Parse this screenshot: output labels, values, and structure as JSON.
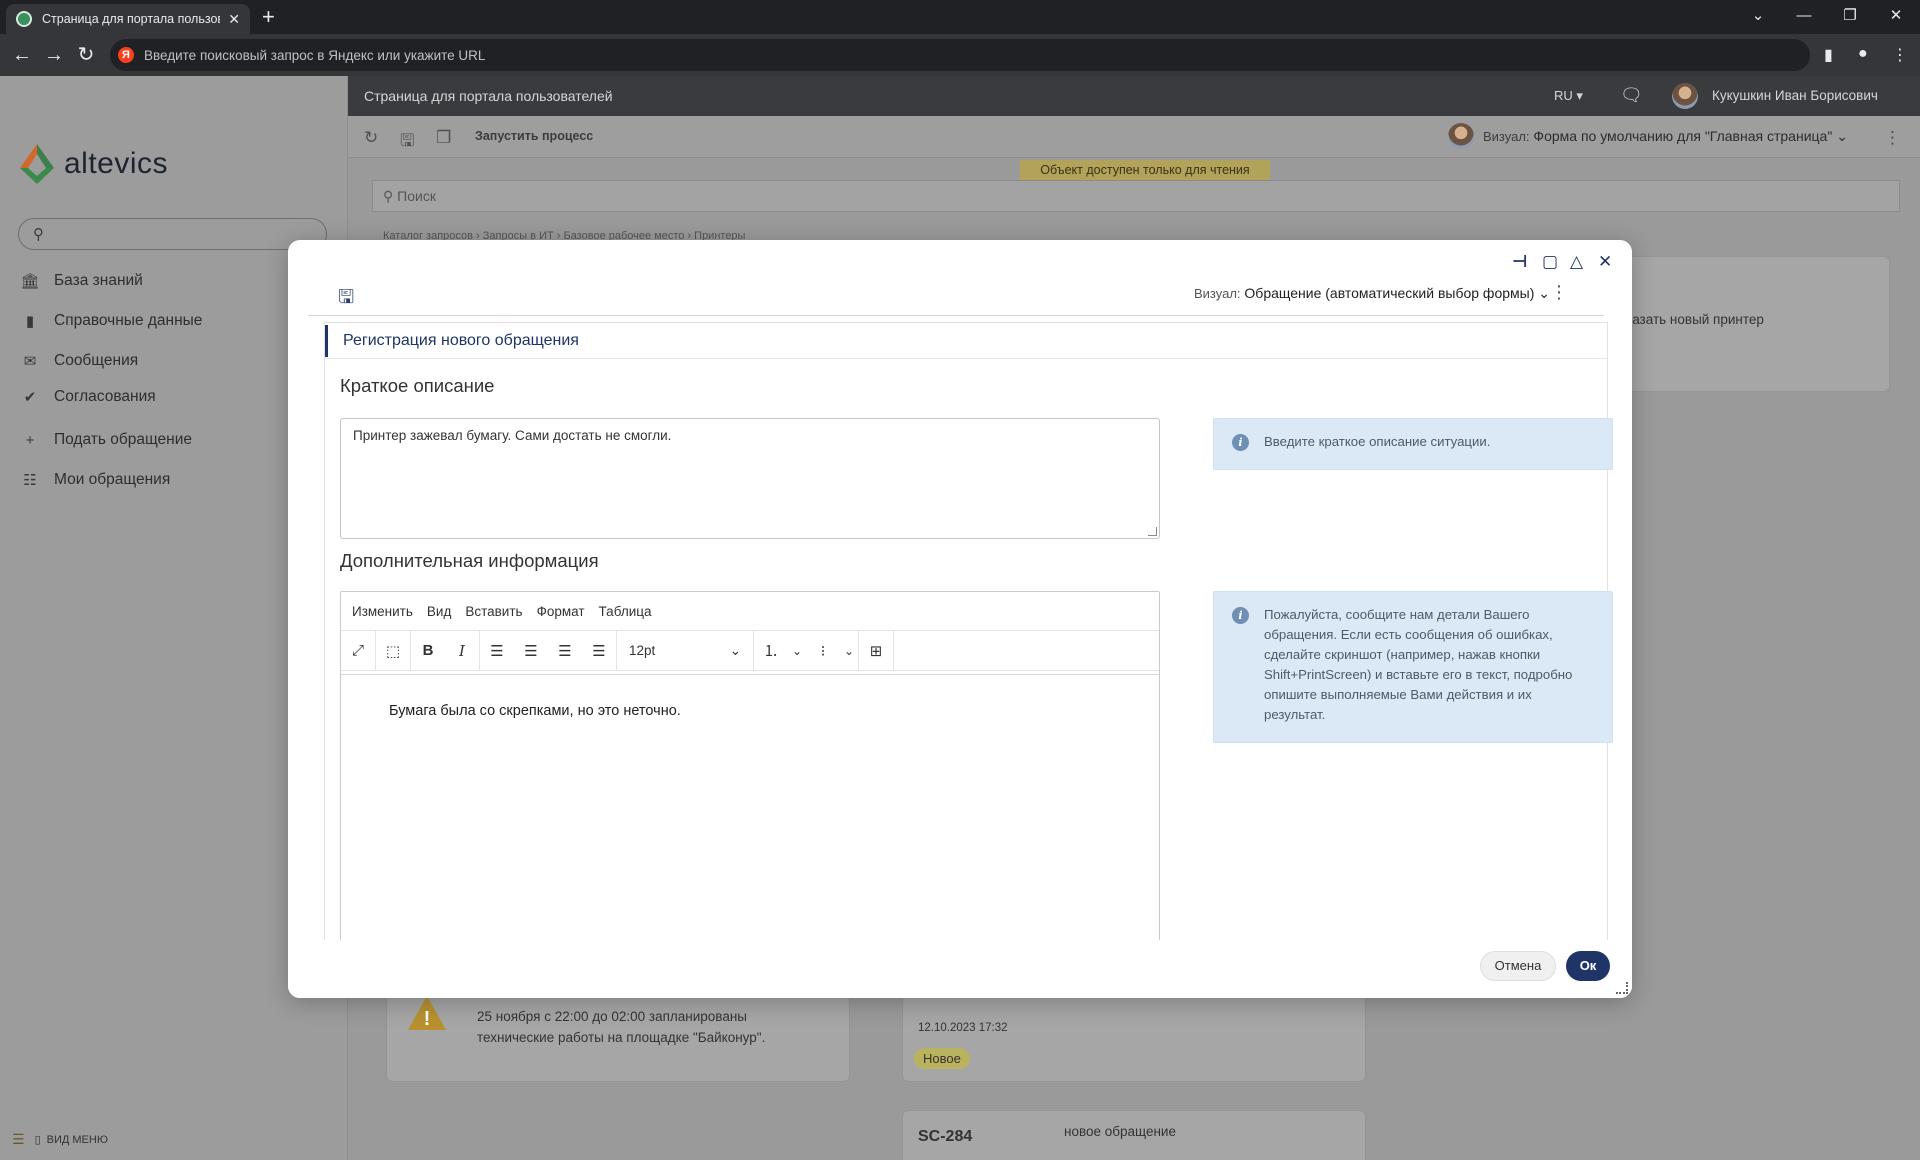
{
  "browser": {
    "tab_title": "Страница для портала пользов",
    "tab_close": "✕",
    "new_tab": "+",
    "address_placeholder": "Введите поисковый запрос в Яндекс или укажите URL",
    "yandex_letter": "Я"
  },
  "app": {
    "title": "Страница для портала пользователей",
    "lang": "RU ▾",
    "user_name": "Кукушкин Иван Борисович",
    "logo_text": "altevics",
    "toolbar": {
      "run_process": "Запустить процесс",
      "visual_label": "Визуал:",
      "visual_value": "Форма по умолчанию для \"Главная страница\""
    },
    "readonly_banner": "Объект доступен только для чтения",
    "search_placeholder": "Поиск",
    "breadcrumbs": "Каталог запросов › Запросы в ИТ › Базовое рабочее место › Принтеры"
  },
  "sidebar": {
    "items": [
      {
        "icon": "bank-icon",
        "label": "База знаний"
      },
      {
        "icon": "book-icon",
        "label": "Справочные данные"
      },
      {
        "icon": "envelope-icon",
        "label": "Сообщения"
      },
      {
        "icon": "check-icon",
        "label": "Согласования"
      },
      {
        "icon": "plus-icon",
        "label": "Подать обращение"
      },
      {
        "icon": "list-icon",
        "label": "Мои обращения"
      }
    ],
    "footer": "ВИД МЕНЮ"
  },
  "background": {
    "printer_card_text": "казать новый принтер",
    "notice_text_1": "25 ноября с 22:00 до 02:00 запланированы",
    "notice_text_2": "технические работы на площадке \"Байконур\".",
    "ticket_date": "12.10.2023 17:32",
    "ticket_status": "Новое",
    "ticket_id": "SC-284",
    "ticket_title": "новое обращение"
  },
  "modal": {
    "visual_label": "Визуал:",
    "visual_value": "Обращение (автоматический выбор формы)",
    "section_title": "Регистрация нового обращения",
    "short_desc_label": "Краткое описание",
    "short_desc_value": "Принтер зажевал бумагу. Сами достать не смогли.",
    "short_desc_hint": "Введите краткое описание ситуации.",
    "extra_info_label": "Дополнительная информация",
    "extra_info_hint": "Пожалуйста, сообщите нам детали Вашего обращения. Если есть сообщения об ошибках, сделайте скриншот (например, нажав кнопки Shift+PrintScreen) и вставьте его в текст, подробно опишите выполняемые Вами действия и их результат.",
    "editor": {
      "menu": [
        "Изменить",
        "Вид",
        "Вставить",
        "Формат",
        "Таблица"
      ],
      "font_size": "12pt",
      "content": "Бумага была со скрепками, но это неточно."
    },
    "cancel_label": "Отмена",
    "ok_label": "Ок"
  },
  "colors": {
    "accent": "#1f3467",
    "hint_bg": "#dbe9f6",
    "banner": "#b2a35a"
  }
}
